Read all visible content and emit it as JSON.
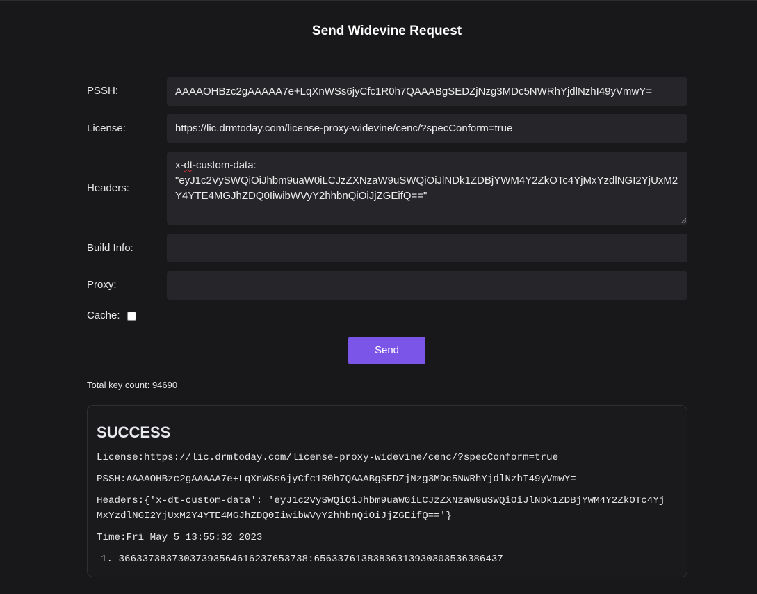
{
  "title": "Send Widevine Request",
  "form": {
    "pssh_label": "PSSH:",
    "pssh_value": "AAAAOHBzc2gAAAAA7e+LqXnWSs6jyCfc1R0h7QAAABgSEDZjNzg3MDc5NWRhYjdlNzhI49yVmwY=",
    "license_label": "License:",
    "license_value": "https://lic.drmtoday.com/license-proxy-widevine/cenc/?specConform=true",
    "headers_label": "Headers:",
    "headers_value_prefix": "x-",
    "headers_value_misspelled": "dt",
    "headers_value_rest": "-custom-data:\n\"eyJ1c2VySWQiOiJhbm9uaW0iLCJzZXNzaW9uSWQiOiJlNDk1ZDBjYWM4Y2ZkOTc4YjMxYzdlNGI2YjUxM2Y4YTE4MGJhZDQ0IiwibWVyY2hhbnQiOiJjZGEifQ==\"",
    "build_info_label": "Build Info:",
    "build_info_value": "",
    "proxy_label": "Proxy:",
    "proxy_value": "",
    "cache_label": "Cache:",
    "cache_checked": false,
    "send_label": "Send"
  },
  "total_key_count_text": "Total key count: 94690",
  "result": {
    "status": "SUCCESS",
    "license_line": "License:https://lic.drmtoday.com/license-proxy-widevine/cenc/?specConform=true",
    "pssh_line": "PSSH:AAAAOHBzc2gAAAAA7e+LqXnWSs6jyCfc1R0h7QAAABgSEDZjNzg3MDc5NWRhYjdlNzhI49yVmwY=",
    "headers_line_1": "Headers:{'x-dt-custom-data': 'eyJ1c2VySWQiOiJhbm9uaW0iLCJzZXNzaW9uSWQiOiJlNDk1ZDBjYWM4Y2ZkOTc4Yj",
    "headers_line_2": "MxYzdlNGI2YjUxM2Y4YTE4MGJhZDQ0IiwibWVyY2hhbnQiOiJjZGEifQ=='}",
    "time_line": "Time:Fri May 5 13:55:32 2023",
    "keys": [
      "36633738373037393564616237653738:65633761383836313930303536386437"
    ]
  },
  "colors": {
    "background": "#18181a",
    "field": "#26262a",
    "accent": "#7b55e7"
  }
}
